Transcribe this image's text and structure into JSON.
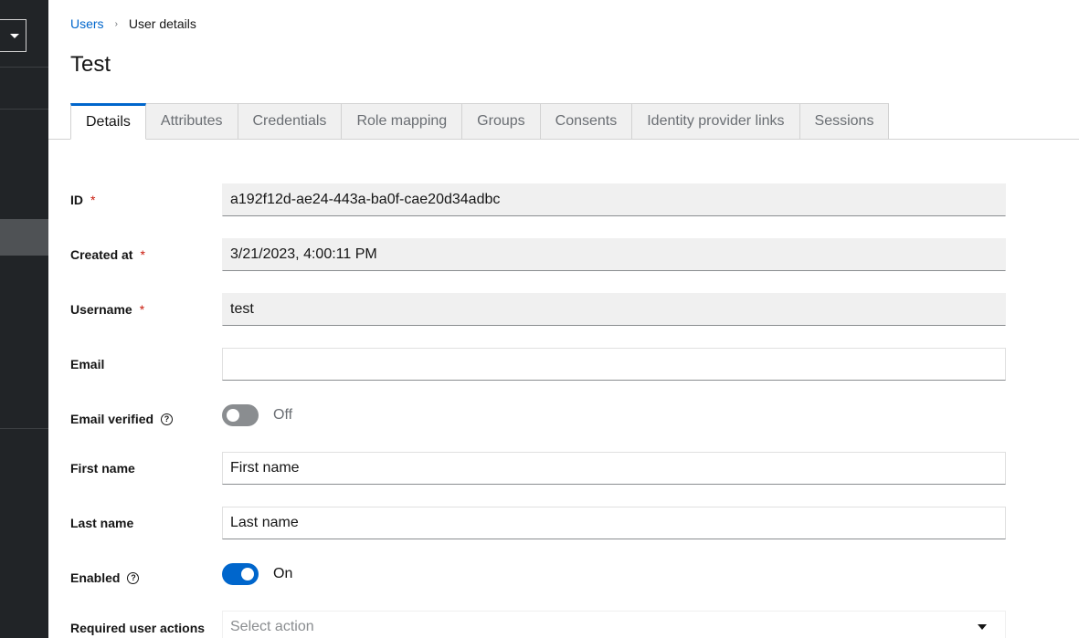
{
  "breadcrumb": {
    "parent": "Users",
    "separator": "›",
    "current": "User details"
  },
  "page": {
    "title": "Test"
  },
  "tabs": [
    {
      "label": "Details",
      "active": true
    },
    {
      "label": "Attributes",
      "active": false
    },
    {
      "label": "Credentials",
      "active": false
    },
    {
      "label": "Role mapping",
      "active": false
    },
    {
      "label": "Groups",
      "active": false
    },
    {
      "label": "Consents",
      "active": false
    },
    {
      "label": "Identity provider links",
      "active": false
    },
    {
      "label": "Sessions",
      "active": false
    }
  ],
  "form": {
    "id": {
      "label": "ID",
      "required": "*",
      "value": "a192f12d-ae24-443a-ba0f-cae20d34adbc"
    },
    "created_at": {
      "label": "Created at",
      "required": "*",
      "value": "3/21/2023, 4:00:11 PM"
    },
    "username": {
      "label": "Username",
      "required": "*",
      "value": "test"
    },
    "email": {
      "label": "Email",
      "value": ""
    },
    "email_verified": {
      "label": "Email verified",
      "help": "?",
      "state_label": "Off",
      "on": false
    },
    "first_name": {
      "label": "First name",
      "placeholder": "First name"
    },
    "last_name": {
      "label": "Last name",
      "placeholder": "Last name"
    },
    "enabled": {
      "label": "Enabled",
      "help": "?",
      "state_label": "On",
      "on": true
    },
    "required_actions": {
      "label": "Required user actions",
      "placeholder": "Select action"
    }
  },
  "colors": {
    "sidebar_bg": "#212427",
    "accent": "#0066cc",
    "required": "#c9190b",
    "readonly_bg": "#f0f0f0"
  }
}
